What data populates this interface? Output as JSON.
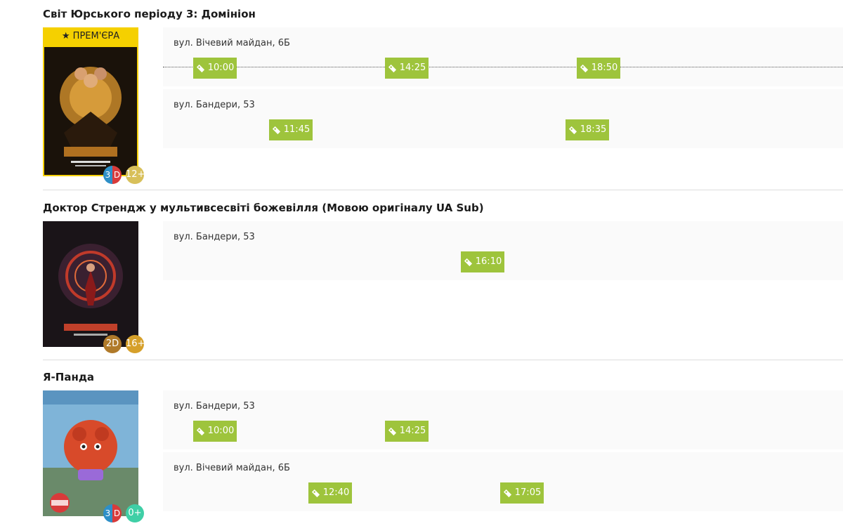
{
  "movies": [
    {
      "title": "Світ Юрського періоду 3: Домініон",
      "premiere_label": "ПРЕМ'ЄРА",
      "format_left": "3",
      "format_right": "D",
      "age": "12+",
      "cinemas": [
        {
          "address": "вул. Вічевий майдан, 6Б",
          "times": [
            "10:00",
            "14:25",
            "18:50"
          ]
        },
        {
          "address": "вул. Бандери, 53",
          "times": [
            "11:45",
            "18:35"
          ]
        }
      ]
    },
    {
      "title": "Доктор Стрендж у мультивсесвіті божевілля (Мовою оригіналу UA Sub)",
      "format": "2D",
      "age": "16+",
      "cinemas": [
        {
          "address": "вул. Бандери, 53",
          "times": [
            "16:10"
          ]
        }
      ]
    },
    {
      "title": "Я-Панда",
      "format_left": "3",
      "format_right": "D",
      "age": "0+",
      "cinemas": [
        {
          "address": "вул. Бандери, 53",
          "times": [
            "10:00",
            "14:25"
          ]
        },
        {
          "address": "вул. Вічевий майдан, 6Б",
          "times": [
            "12:40",
            "17:05"
          ]
        }
      ]
    }
  ],
  "colors": {
    "session": "#9ec43c",
    "premiere": "#f5d000",
    "age_12": "#d8c05a",
    "age_16": "#d6a02a",
    "age_0": "#3fcfa6",
    "format_2d": "#b07a2a"
  },
  "icons": {
    "session": "ticket-icon",
    "premiere": "star-icon"
  }
}
